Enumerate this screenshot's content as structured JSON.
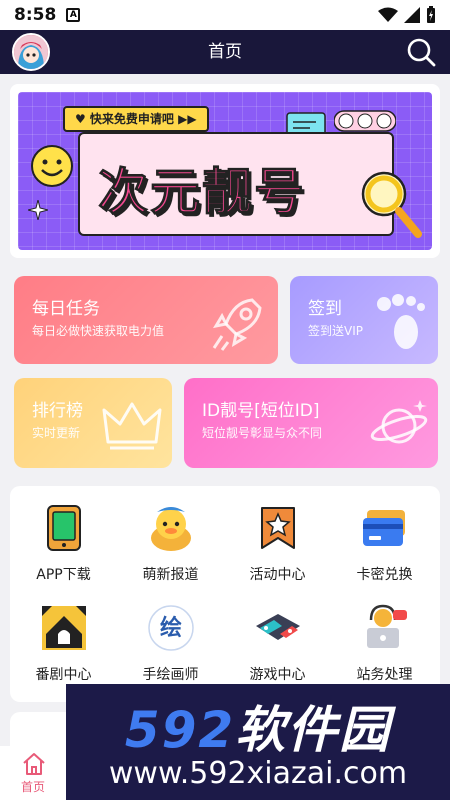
{
  "status_bar": {
    "time": "8:58",
    "notif_letter": "A"
  },
  "header": {
    "title": "首页"
  },
  "banner": {
    "tag": "♥ 快来免费申请吧 ▶▶",
    "title": "次元靓号"
  },
  "cards": {
    "daily": {
      "title": "每日任务",
      "subtitle": "每日必做快速获取电力值"
    },
    "signin": {
      "title": "签到",
      "subtitle": "签到送VIP"
    },
    "rank": {
      "title": "排行榜",
      "subtitle": "实时更新"
    },
    "idnum": {
      "title": "ID靓号[短位ID]",
      "subtitle": "短位靓号彰显与众不同"
    }
  },
  "grid": [
    {
      "label": "APP下载",
      "icon": "phone-icon"
    },
    {
      "label": "萌新报道",
      "icon": "duck-mascot-icon"
    },
    {
      "label": "活动中心",
      "icon": "star-badge-icon"
    },
    {
      "label": "卡密兑换",
      "icon": "card-icon"
    },
    {
      "label": "番剧中心",
      "icon": "tv-house-icon"
    },
    {
      "label": "手绘画师",
      "icon": "paint-logo-icon"
    },
    {
      "label": "游戏中心",
      "icon": "game-console-icon"
    },
    {
      "label": "站务处理",
      "icon": "support-agent-icon"
    }
  ],
  "paint_logo_text": "绘",
  "bottom_nav": {
    "home_label": "首页"
  },
  "watermark": {
    "brand_num": "592",
    "brand_cn": "软件园",
    "url": "www.592xiazai.com"
  },
  "colors": {
    "topbar": "#19173a",
    "accent_pink": "#e85a78"
  }
}
